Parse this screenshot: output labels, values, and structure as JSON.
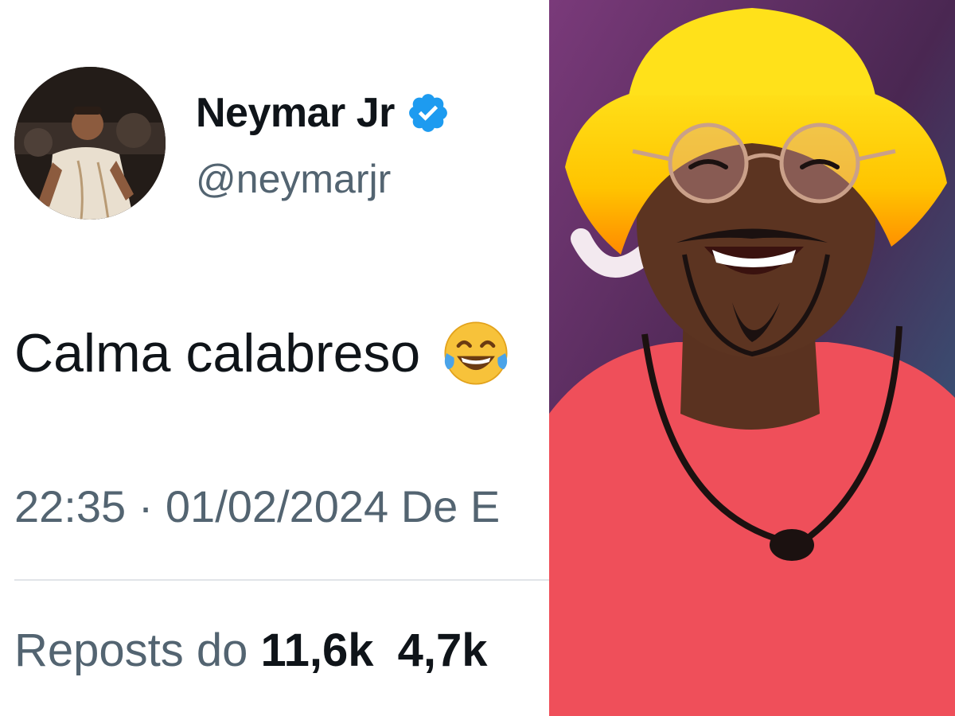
{
  "tweet": {
    "display_name": "Neymar Jr",
    "handle": "@neymarjr",
    "text": "Calma calabreso",
    "timestamp": "22:35 · 01/02/2024 De E",
    "reposts_label": "Repost",
    "reposts_suffix": "s do",
    "reposts_count": "11,6k",
    "likes_count": "4,7k",
    "verified_icon": "verified-badge-icon",
    "emoji_icon": "tears-of-joy-emoji-icon",
    "colors": {
      "verified": "#1d9bf0",
      "text": "#0f1419",
      "secondary": "#536471"
    }
  },
  "photo": {
    "subject": "man-in-yellow-bucket-hat-and-red-shirt"
  }
}
